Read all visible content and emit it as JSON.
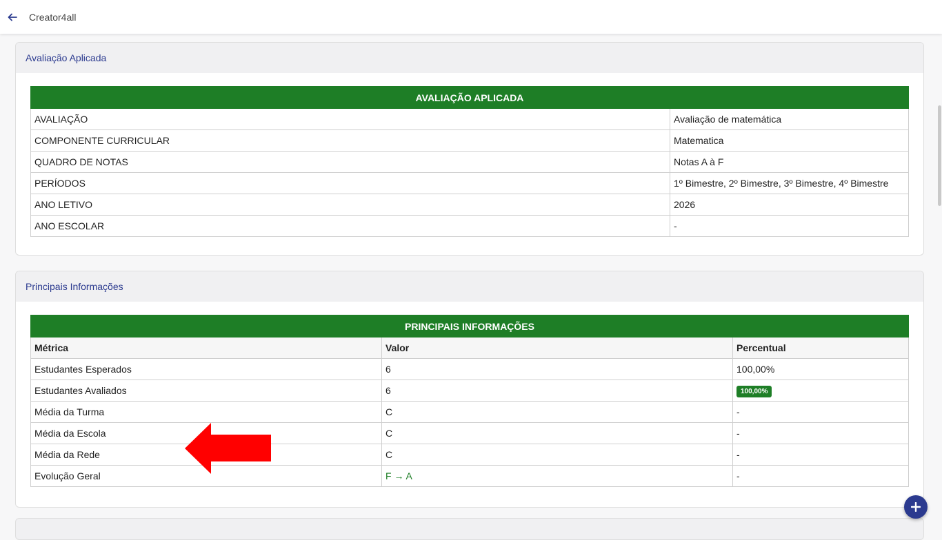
{
  "app": {
    "title": "Creator4all"
  },
  "cards": {
    "applied": {
      "header": "Avaliação Aplicada",
      "banner": "AVALIAÇÃO APLICADA",
      "rows": [
        {
          "label": "AVALIAÇÃO",
          "value": "Avaliação de matemática"
        },
        {
          "label": "COMPONENTE CURRICULAR",
          "value": "Matematica"
        },
        {
          "label": "QUADRO DE NOTAS",
          "value": "Notas A à F"
        },
        {
          "label": "PERÍODOS",
          "value": "1º Bimestre, 2º Bimestre, 3º Bimestre, 4º Bimestre"
        },
        {
          "label": "ANO LETIVO",
          "value": "2026"
        },
        {
          "label": "ANO ESCOLAR",
          "value": "-"
        }
      ]
    },
    "main": {
      "header": "Principais Informações",
      "banner": "PRINCIPAIS INFORMAÇÕES",
      "columns": [
        "Métrica",
        "Valor",
        "Percentual"
      ],
      "rows": [
        {
          "metric": "Estudantes Esperados",
          "value": "6",
          "percent": "100,00%"
        },
        {
          "metric": "Estudantes Avaliados",
          "value": "6",
          "percent": "100,00%"
        },
        {
          "metric": "Média da Turma",
          "value": "C",
          "percent": "-"
        },
        {
          "metric": "Média da Escola",
          "value": "C",
          "percent": "-"
        },
        {
          "metric": "Média da Rede",
          "value": "C",
          "percent": "-"
        },
        {
          "metric": "Evolução Geral",
          "value": "F → A",
          "percent": "-"
        }
      ]
    }
  },
  "colors": {
    "accent": "#2b3a8f",
    "table_header": "#1e7e26",
    "annotation_arrow": "#ff0000"
  },
  "icons": {
    "back": "arrow-left-icon",
    "fab": "plus-icon"
  }
}
